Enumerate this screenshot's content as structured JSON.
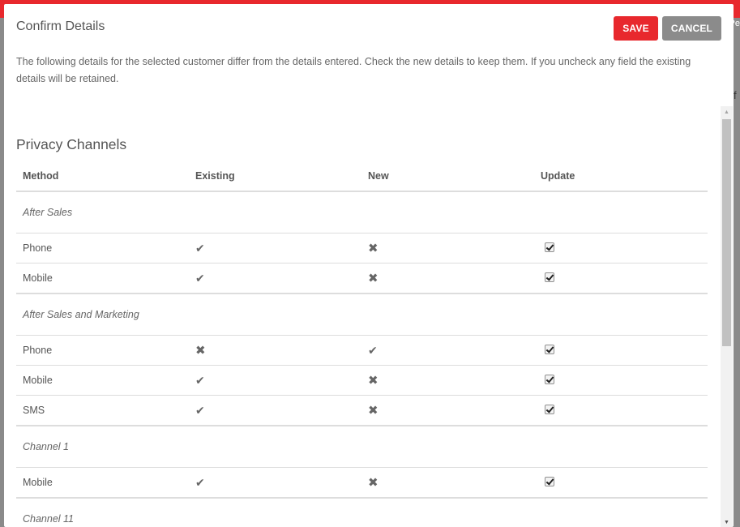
{
  "topbar": {
    "edge_text": "Pe",
    "accent": "#e8282d"
  },
  "background": {
    "edge_glyph": "f"
  },
  "modal": {
    "title": "Confirm Details",
    "save_label": "SAVE",
    "cancel_label": "CANCEL",
    "description": "The following details for the selected customer differ from the details entered. Check the new details to keep them. If you uncheck any field the existing details will be retained."
  },
  "privacy": {
    "section_title": "Privacy Channels",
    "headers": {
      "method": "Method",
      "existing": "Existing",
      "new": "New",
      "update": "Update"
    },
    "groups": [
      {
        "name": "After Sales",
        "rows": [
          {
            "method": "Phone",
            "existing": "check-icon",
            "new": "cross-icon",
            "update": true
          },
          {
            "method": "Mobile",
            "existing": "check-icon",
            "new": "cross-icon",
            "update": true
          }
        ]
      },
      {
        "name": "After Sales and Marketing",
        "rows": [
          {
            "method": "Phone",
            "existing": "cross-icon",
            "new": "check-icon",
            "update": true
          },
          {
            "method": "Mobile",
            "existing": "check-icon",
            "new": "cross-icon",
            "update": true
          },
          {
            "method": "SMS",
            "existing": "check-icon",
            "new": "cross-icon",
            "update": true
          }
        ]
      },
      {
        "name": "Channel 1",
        "rows": [
          {
            "method": "Mobile",
            "existing": "check-icon",
            "new": "cross-icon",
            "update": true
          }
        ]
      },
      {
        "name": "Channel 11",
        "rows": []
      }
    ]
  }
}
